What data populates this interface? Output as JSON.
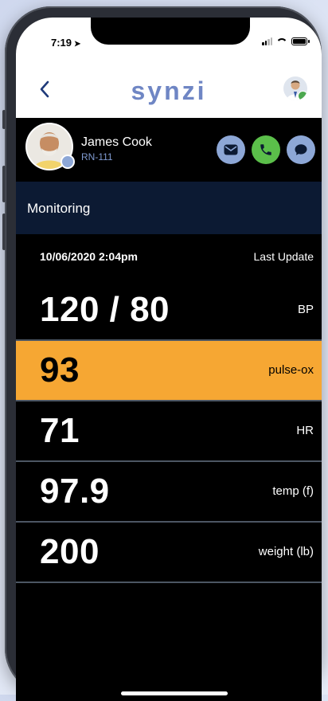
{
  "status_bar": {
    "time": "7:19"
  },
  "nav": {
    "brand": "synzi"
  },
  "patient": {
    "name": "James Cook",
    "id": "RN-111"
  },
  "section": {
    "title": "Monitoring"
  },
  "update": {
    "datetime": "10/06/2020 2:04pm",
    "label": "Last Update"
  },
  "vitals": [
    {
      "value": "120 / 80",
      "label": "BP",
      "alert": false
    },
    {
      "value": "93",
      "label": "pulse-ox",
      "alert": true
    },
    {
      "value": "71",
      "label": "HR",
      "alert": false
    },
    {
      "value": "97.9",
      "label": "temp (f)",
      "alert": false
    },
    {
      "value": "200",
      "label": "weight (lb)",
      "alert": false
    }
  ],
  "colors": {
    "brand": "#6f86c4",
    "alert": "#f6a733",
    "call": "#5bbf4a",
    "action": "#8da7d6",
    "section_bar": "#0c1a33"
  },
  "icons": {
    "back": "chevron-left-icon",
    "email": "envelope-icon",
    "call": "phone-icon",
    "chat": "chat-bubble-icon"
  }
}
